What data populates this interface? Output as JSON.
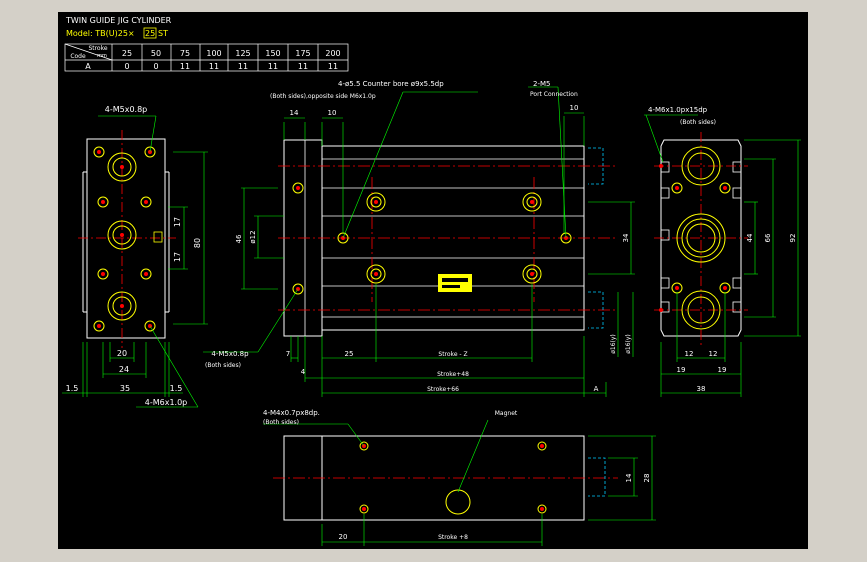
{
  "title": {
    "line1": "TWIN GUIDE JIG CYLINDER",
    "line2_prefix": "Model: TB(U)25×",
    "line2_box": "25",
    "line2_suffix": "ST"
  },
  "stroke_table": {
    "header_stroke": "Stroke",
    "header_code": "Code",
    "header_unit": "mm",
    "strokes": [
      "25",
      "50",
      "75",
      "100",
      "125",
      "150",
      "175",
      "200"
    ],
    "row_label": "A",
    "a_values": [
      "0",
      "0",
      "11",
      "11",
      "11",
      "11",
      "11",
      "11"
    ]
  },
  "callouts": {
    "counterbore": "4-ø5.5 Counter bore ø9x5.5dp",
    "counterbore_sub": "(Both sides),opposite side M6x1.0p",
    "port": "2-M5",
    "port_sub": "Port Connection",
    "right_tap": "4-M6x1.0px15dp",
    "right_tap_sub": "(Both sides)",
    "left_tap": "4-M5x0.8p",
    "bottom_left_tap": "4-M5x0.8p",
    "bottom_left_tap_sub": "(Both sides)",
    "left_bottom_tap": "4-M6x1.0p",
    "bottom_view_tap": "4-M4x0.7px8dp.",
    "bottom_view_tap_sub": "(Both sides)",
    "magnet": "Magnet"
  },
  "dims": {
    "left_20": "20",
    "left_24": "24",
    "left_35": "35",
    "left_15a": "1.5",
    "left_15b": "1.5",
    "left_17a": "17",
    "left_17b": "17",
    "left_80": "80",
    "front_14": "14",
    "front_10a": "10",
    "front_10b": "10",
    "front_46": "46",
    "front_phi12": "ø12",
    "front_34": "34",
    "front_phi16a": "ø16(y)",
    "front_phi16b": "ø16(y)",
    "front_7": "7",
    "front_25": "25",
    "front_strokeZ": "Stroke - Z",
    "front_4": "4",
    "front_stroke48": "Stroke+48",
    "front_stroke66": "Stroke+66",
    "front_A": "A",
    "right_44": "44",
    "right_66": "66",
    "right_92": "92",
    "right_12a": "12",
    "right_12b": "12",
    "right_19a": "19",
    "right_19b": "19",
    "right_38": "38",
    "bottom_14": "14",
    "bottom_28": "28",
    "bottom_20": "20",
    "bottom_stroke8": "Stroke +8"
  }
}
